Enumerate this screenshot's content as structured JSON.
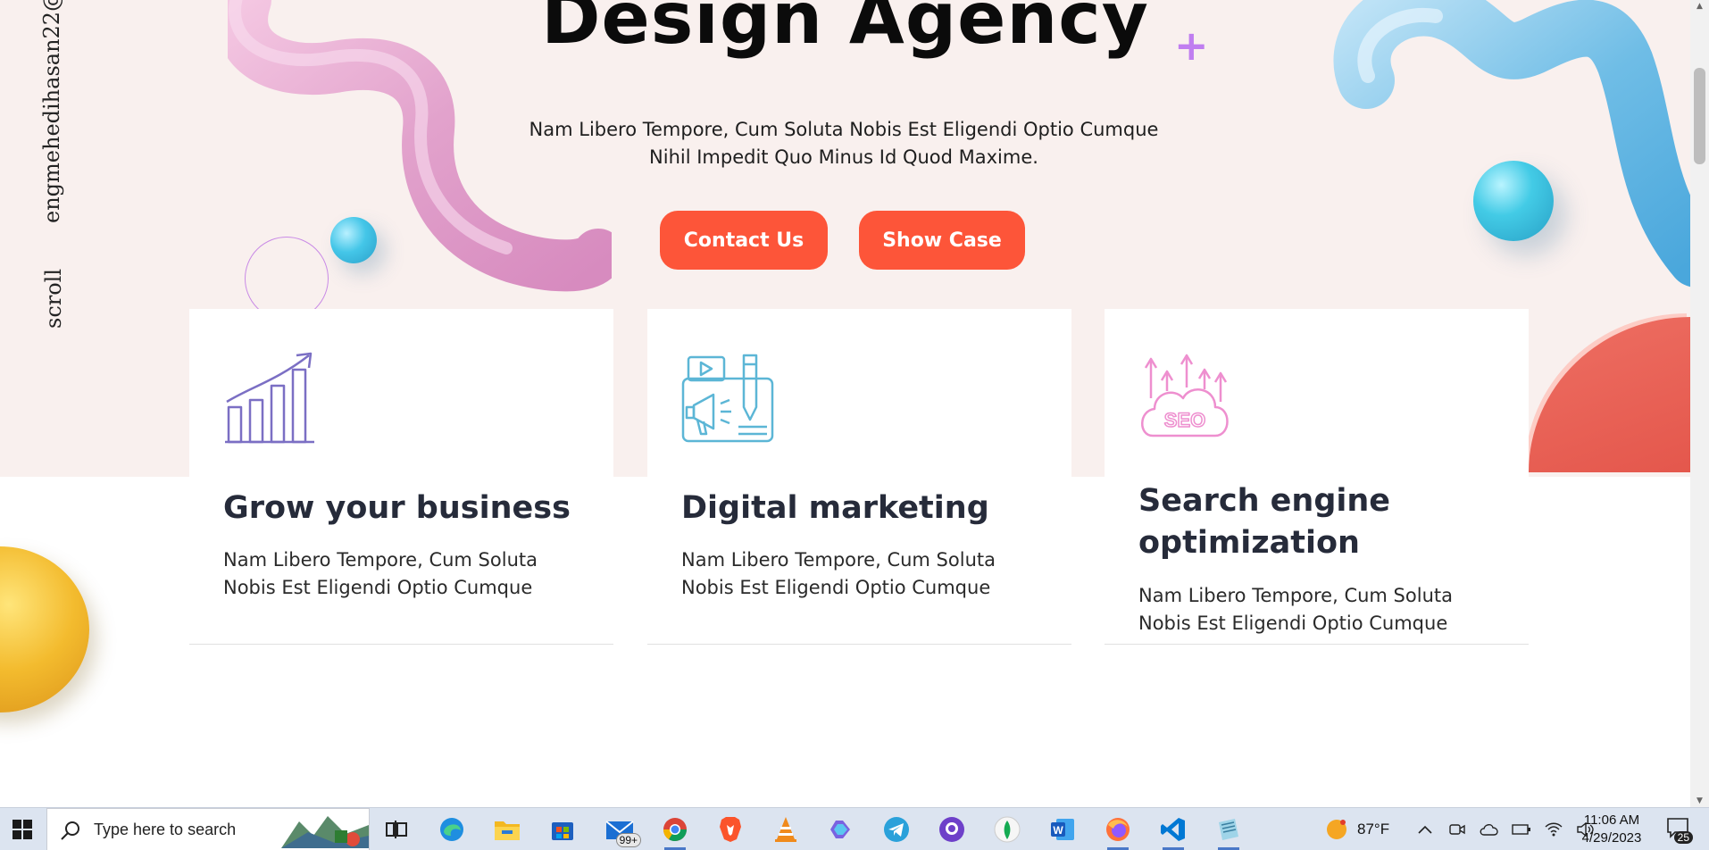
{
  "hero": {
    "title": "Design Agency",
    "description": "Nam Libero Tempore, Cum Soluta Nobis Est Eligendi Optio Cumque Nihil Impedit Quo Minus Id Quod Maxime.",
    "contact_label": "Contact Us",
    "showcase_label": "Show Case",
    "accent_color": "#fd5539"
  },
  "side": {
    "email": "engmehedihasan22@",
    "scroll": "scroll"
  },
  "services": [
    {
      "title": "Grow your business",
      "text": "Nam Libero Tempore, Cum Soluta Nobis Est Eligendi Optio Cumque",
      "icon": "growth-chart-icon",
      "icon_color": "#7b6fc4"
    },
    {
      "title": "Digital marketing",
      "text": "Nam Libero Tempore, Cum Soluta Nobis Est Eligendi Optio Cumque",
      "icon": "digital-marketing-icon",
      "icon_color": "#5cb6d6"
    },
    {
      "title": "Search engine optimization",
      "text": "Nam Libero Tempore, Cum Soluta Nobis Est Eligendi Optio Cumque",
      "icon": "seo-cloud-icon",
      "icon_color": "#ee8fcf",
      "icon_text": "SEO"
    }
  ],
  "taskbar": {
    "search_placeholder": "Type here to search",
    "mail_badge": "99+",
    "weather_temp": "87°F",
    "time": "11:06 AM",
    "date": "4/29/2023",
    "notification_count": "25",
    "apps": [
      "task-view",
      "edge",
      "file-explorer",
      "microsoft-store",
      "mail",
      "chrome",
      "brave",
      "vlc",
      "copilot",
      "telegram",
      "github-desktop",
      "mongodb-compass",
      "word",
      "firefox",
      "vscode",
      "notepad"
    ]
  }
}
